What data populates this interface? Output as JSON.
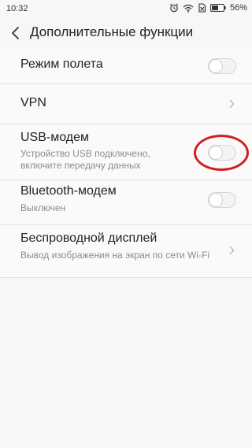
{
  "status_bar": {
    "time": "10:32",
    "battery": "56%"
  },
  "header": {
    "title": "Дополнительные функции"
  },
  "items": [
    {
      "label": "Режим полета",
      "control": "toggle",
      "state": "off"
    },
    {
      "label": "VPN",
      "control": "chevron"
    },
    {
      "label": "USB-модем",
      "sub": "Устройство USB подключено, включите передачу данных",
      "control": "toggle",
      "state": "off",
      "highlighted": true
    },
    {
      "label": "Bluetooth-модем",
      "sub": "Выключен",
      "control": "toggle",
      "state": "off"
    },
    {
      "label": "Беспроводной дисплей",
      "sub": "Вывод изображения на экран по сети Wi-Fi",
      "control": "chevron"
    }
  ],
  "icons": [
    "back-arrow-icon",
    "alarm-icon",
    "wifi-icon",
    "no-sim-icon",
    "battery-icon",
    "chevron-right-icon"
  ],
  "colors": {
    "annotation": "#d21f1f",
    "background": "#f7f7f7"
  }
}
